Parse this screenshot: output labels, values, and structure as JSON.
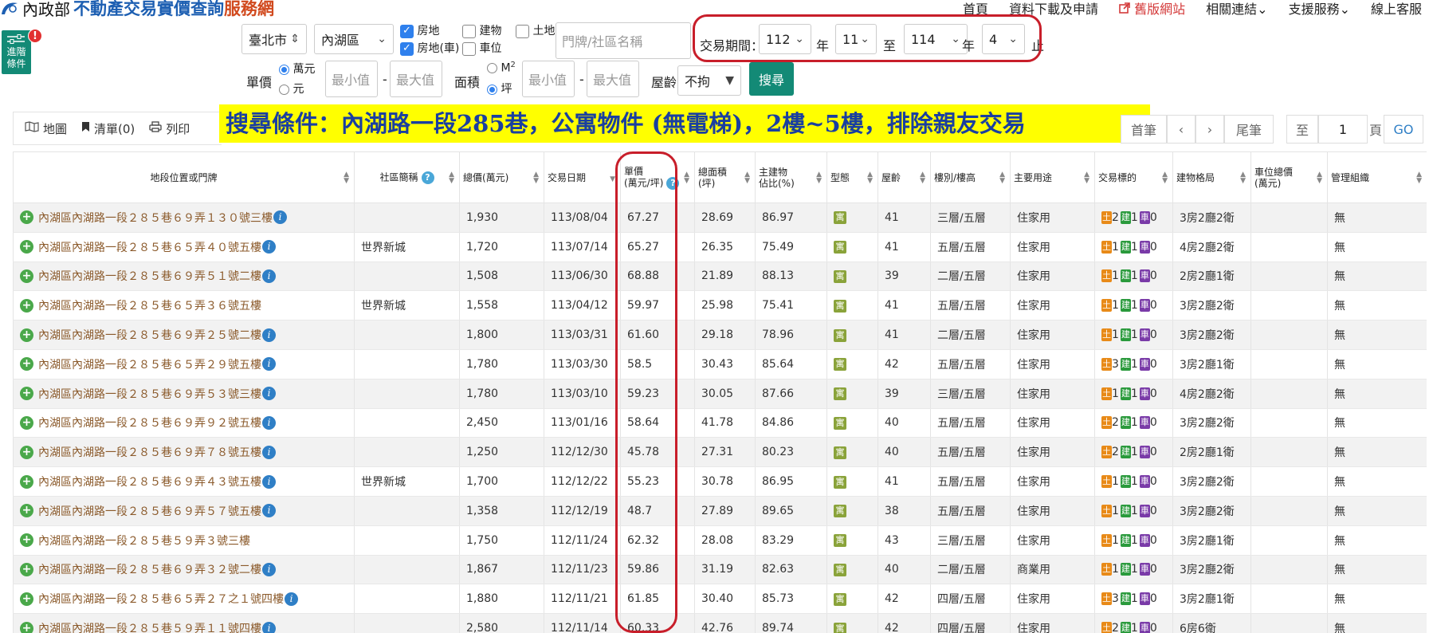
{
  "header": {
    "ministry": "內政部",
    "site_part1": "不動產交易實價查詢",
    "site_part2": "服務網",
    "nav": [
      {
        "label": "首頁"
      },
      {
        "label": "資料下載及申請"
      },
      {
        "label": "舊版網站",
        "icon": "external-link-icon"
      },
      {
        "label": "相關連結⌄"
      },
      {
        "label": "支援服務⌄"
      },
      {
        "label": "線上客服"
      }
    ]
  },
  "advanced": {
    "label_line1": "進階",
    "label_line2": "條件",
    "badge": "!"
  },
  "filters": {
    "city": "臺北市",
    "district": "內湖區",
    "types": [
      {
        "label": "房地",
        "checked": true
      },
      {
        "label": "建物",
        "checked": false
      },
      {
        "label": "土地",
        "checked": false
      },
      {
        "label": "房地(車)",
        "checked": true
      },
      {
        "label": "車位",
        "checked": false
      }
    ],
    "address_placeholder": "門牌/社區名稱",
    "period_label": "交易期間：",
    "start_year": "112",
    "year_unit": "年",
    "start_month": "11",
    "to_label": "至",
    "end_year": "114",
    "end_month": "4",
    "end_label": "止",
    "unit_price_label": "單價",
    "unit_price_options": [
      "萬元",
      "元"
    ],
    "min_placeholder": "最小值",
    "dash": "-",
    "max_placeholder": "最大值",
    "area_label": "面積",
    "area_options": [
      "M",
      "坪"
    ],
    "area_superscript": "2",
    "age_label": "屋齡",
    "age_value": "不拘",
    "search_button": "搜尋"
  },
  "banner": "搜尋條件：內湖路一段285巷，公寓物件 (無電梯)，2樓~5樓，排除親友交易",
  "toolbar": {
    "map": "地圖",
    "list": "清單(0)",
    "print": "列印"
  },
  "pager": {
    "first": "首筆",
    "prev": "‹",
    "next": "›",
    "last": "尾筆",
    "to": "至",
    "page": "1",
    "page_unit": "頁",
    "go": "GO"
  },
  "table": {
    "headers": [
      "地段位置或門牌",
      "社區簡稱",
      "總價(萬元)",
      "交易日期",
      "單價\n(萬元/坪)",
      "總面積\n(坪)",
      "主建物\n佔比(%)",
      "型態",
      "屋齡",
      "樓別/樓高",
      "主要用途",
      "交易標的",
      "建物格局",
      "車位總價\n(萬元)",
      "管理組織"
    ],
    "type_icon": "寓",
    "tag_labels": {
      "land": "土",
      "building": "建",
      "parking": "車"
    },
    "rows": [
      {
        "addr": "內湖區內湖路一段２８５巷６９弄１３０號三樓",
        "info": true,
        "community": "",
        "total": "1,930",
        "date": "113/08/04",
        "unit": "67.27",
        "area": "28.69",
        "main": "86.97",
        "age": "41",
        "floor": "三層/五層",
        "use": "住家用",
        "land": "2",
        "bldg": "1",
        "park": "0",
        "layout": "3房2廳2衛",
        "parking_total": "",
        "mgmt": "無"
      },
      {
        "addr": "內湖區內湖路一段２８５巷６５弄４０號五樓",
        "info": true,
        "community": "世界新城",
        "total": "1,720",
        "date": "113/07/14",
        "unit": "65.27",
        "area": "26.35",
        "main": "75.49",
        "age": "41",
        "floor": "五層/五層",
        "use": "住家用",
        "land": "1",
        "bldg": "1",
        "park": "0",
        "layout": "4房2廳2衛",
        "parking_total": "",
        "mgmt": "無"
      },
      {
        "addr": "內湖區內湖路一段２８５巷６９弄５１號二樓",
        "info": true,
        "community": "",
        "total": "1,508",
        "date": "113/06/30",
        "unit": "68.88",
        "area": "21.89",
        "main": "88.13",
        "age": "39",
        "floor": "二層/五層",
        "use": "住家用",
        "land": "1",
        "bldg": "1",
        "park": "0",
        "layout": "2房2廳1衛",
        "parking_total": "",
        "mgmt": "無"
      },
      {
        "addr": "內湖區內湖路一段２８５巷６５弄３６號五樓",
        "info": false,
        "community": "世界新城",
        "total": "1,558",
        "date": "113/04/12",
        "unit": "59.97",
        "area": "25.98",
        "main": "75.41",
        "age": "41",
        "floor": "五層/五層",
        "use": "住家用",
        "land": "1",
        "bldg": "1",
        "park": "0",
        "layout": "3房2廳2衛",
        "parking_total": "",
        "mgmt": "無"
      },
      {
        "addr": "內湖區內湖路一段２８５巷６９弄２５號二樓",
        "info": true,
        "community": "",
        "total": "1,800",
        "date": "113/03/31",
        "unit": "61.60",
        "area": "29.18",
        "main": "78.96",
        "age": "41",
        "floor": "二層/五層",
        "use": "住家用",
        "land": "1",
        "bldg": "1",
        "park": "0",
        "layout": "3房2廳2衛",
        "parking_total": "",
        "mgmt": "無"
      },
      {
        "addr": "內湖區內湖路一段２８５巷６５弄２９號五樓",
        "info": true,
        "community": "",
        "total": "1,780",
        "date": "113/03/30",
        "unit": "58.5",
        "area": "30.43",
        "main": "85.64",
        "age": "42",
        "floor": "五層/五層",
        "use": "住家用",
        "land": "3",
        "bldg": "1",
        "park": "0",
        "layout": "3房2廳1衛",
        "parking_total": "",
        "mgmt": "無"
      },
      {
        "addr": "內湖區內湖路一段２８５巷６９弄５３號三樓",
        "info": true,
        "community": "",
        "total": "1,780",
        "date": "113/03/10",
        "unit": "59.23",
        "area": "30.05",
        "main": "87.66",
        "age": "39",
        "floor": "三層/五層",
        "use": "住家用",
        "land": "1",
        "bldg": "1",
        "park": "0",
        "layout": "4房2廳2衛",
        "parking_total": "",
        "mgmt": "無"
      },
      {
        "addr": "內湖區內湖路一段２８５巷６９弄９２號五樓",
        "info": true,
        "community": "",
        "total": "2,450",
        "date": "113/01/16",
        "unit": "58.64",
        "area": "41.78",
        "main": "84.86",
        "age": "40",
        "floor": "五層/五層",
        "use": "住家用",
        "land": "2",
        "bldg": "1",
        "park": "0",
        "layout": "3房2廳2衛",
        "parking_total": "",
        "mgmt": "無"
      },
      {
        "addr": "內湖區內湖路一段２８５巷６９弄７８號五樓",
        "info": true,
        "community": "",
        "total": "1,250",
        "date": "112/12/30",
        "unit": "45.78",
        "area": "27.31",
        "main": "80.23",
        "age": "40",
        "floor": "五層/五層",
        "use": "住家用",
        "land": "2",
        "bldg": "1",
        "park": "0",
        "layout": "2房2廳1衛",
        "parking_total": "",
        "mgmt": "無"
      },
      {
        "addr": "內湖區內湖路一段２８５巷６９弄４３號五樓",
        "info": true,
        "community": "世界新城",
        "total": "1,700",
        "date": "112/12/22",
        "unit": "55.23",
        "area": "30.78",
        "main": "86.95",
        "age": "41",
        "floor": "五層/五層",
        "use": "住家用",
        "land": "1",
        "bldg": "1",
        "park": "0",
        "layout": "3房2廳2衛",
        "parking_total": "",
        "mgmt": "無"
      },
      {
        "addr": "內湖區內湖路一段２８５巷６９弄５７號五樓",
        "info": true,
        "community": "",
        "total": "1,358",
        "date": "112/12/19",
        "unit": "48.7",
        "area": "27.89",
        "main": "89.65",
        "age": "38",
        "floor": "五層/五層",
        "use": "住家用",
        "land": "1",
        "bldg": "1",
        "park": "0",
        "layout": "3房2廳2衛",
        "parking_total": "",
        "mgmt": "無"
      },
      {
        "addr": "內湖區內湖路一段２８５巷５９弄３號三樓",
        "info": false,
        "community": "",
        "total": "1,750",
        "date": "112/11/24",
        "unit": "62.32",
        "area": "28.08",
        "main": "83.29",
        "age": "43",
        "floor": "三層/五層",
        "use": "住家用",
        "land": "1",
        "bldg": "1",
        "park": "0",
        "layout": "3房2廳1衛",
        "parking_total": "",
        "mgmt": "無"
      },
      {
        "addr": "內湖區內湖路一段２８５巷６９弄３２號二樓",
        "info": true,
        "community": "",
        "total": "1,867",
        "date": "112/11/23",
        "unit": "59.86",
        "area": "31.19",
        "main": "82.63",
        "age": "40",
        "floor": "二層/五層",
        "use": "商業用",
        "land": "1",
        "bldg": "1",
        "park": "0",
        "layout": "3房2廳2衛",
        "parking_total": "",
        "mgmt": "無"
      },
      {
        "addr": "內湖區內湖路一段２８５巷６５弄２７之１號四樓",
        "info": true,
        "community": "",
        "total": "1,880",
        "date": "112/11/21",
        "unit": "61.85",
        "area": "30.40",
        "main": "85.73",
        "age": "42",
        "floor": "四層/五層",
        "use": "住家用",
        "land": "3",
        "bldg": "1",
        "park": "0",
        "layout": "3房2廳1衛",
        "parking_total": "",
        "mgmt": "無"
      },
      {
        "addr": "內湖區內湖路一段２８５巷５９弄１１號四樓",
        "info": true,
        "community": "",
        "total": "2,580",
        "date": "112/11/14",
        "unit": "60.33",
        "area": "42.76",
        "main": "89.74",
        "age": "42",
        "floor": "四層/五層",
        "use": "住家用",
        "land": "2",
        "bldg": "1",
        "park": "0",
        "layout": "6房6衛",
        "parking_total": "",
        "mgmt": "無"
      }
    ]
  }
}
